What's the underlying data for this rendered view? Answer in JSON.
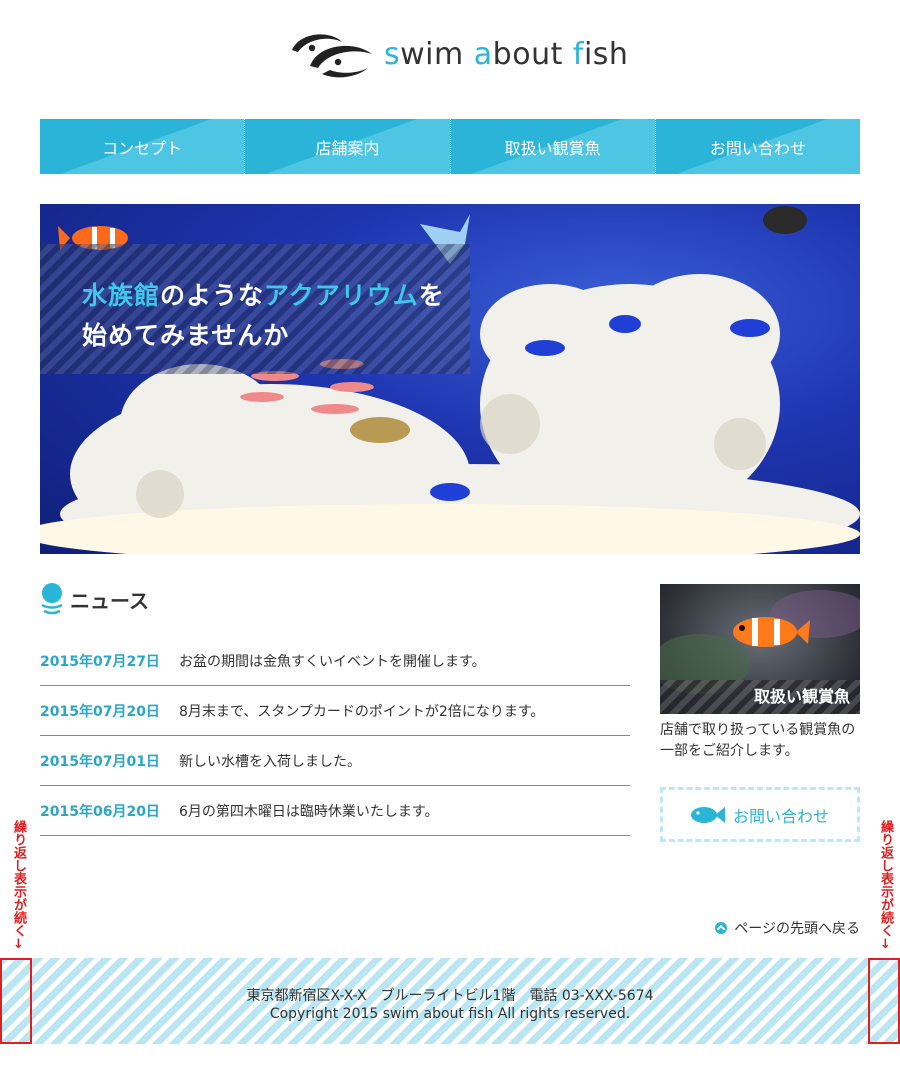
{
  "header": {
    "logo": {
      "part1_accent": "s",
      "part1": "wim ",
      "part2_accent": "a",
      "part2": "bout ",
      "part3_accent": "f",
      "part3": "ish"
    }
  },
  "nav": {
    "items": [
      {
        "label": "コンセプト"
      },
      {
        "label": "店舗案内"
      },
      {
        "label": "取扱い観賞魚"
      },
      {
        "label": "お問い合わせ"
      }
    ]
  },
  "hero": {
    "line1_hl1": "水族館",
    "line1_mid": "のような",
    "line1_hl2": "アクアリウム",
    "line1_end": "を",
    "line2": "始めてみませんか"
  },
  "news": {
    "title": "ニュース",
    "items": [
      {
        "date": "2015年07月27日",
        "text": "お盆の期間は金魚すくいイベントを開催します。"
      },
      {
        "date": "2015年07月20日",
        "text": "8月末まで、スタンプカードのポイントが2倍になります。"
      },
      {
        "date": "2015年07月01日",
        "text": "新しい水槽を入荷しました。"
      },
      {
        "date": "2015年06月20日",
        "text": "6月の第四木曜日は臨時休業いたします。"
      }
    ]
  },
  "sidebar": {
    "card_label": "取扱い観賞魚",
    "card_desc": "店舗で取り扱っている観賞魚の一部をご紹介します。",
    "contact_label": "お問い合わせ"
  },
  "totop": {
    "label": "ページの先頭へ戻る"
  },
  "footer": {
    "address": "東京都新宿区X-X-X　ブルーライトビル1階　電話 03-XXX-5674",
    "copyright": "Copyright 2015 swim about fish All rights reserved."
  },
  "annotation": {
    "repeat_note": "繰り返し表示が続く↓"
  },
  "colors": {
    "accent": "#29b6d6",
    "nav": "#2ab5d8",
    "annotation": "#e02020"
  },
  "icons": {
    "logo": "fish-logo-icon",
    "news": "bubble-icon",
    "contact": "fish-icon",
    "totop": "up-arrow-icon"
  }
}
